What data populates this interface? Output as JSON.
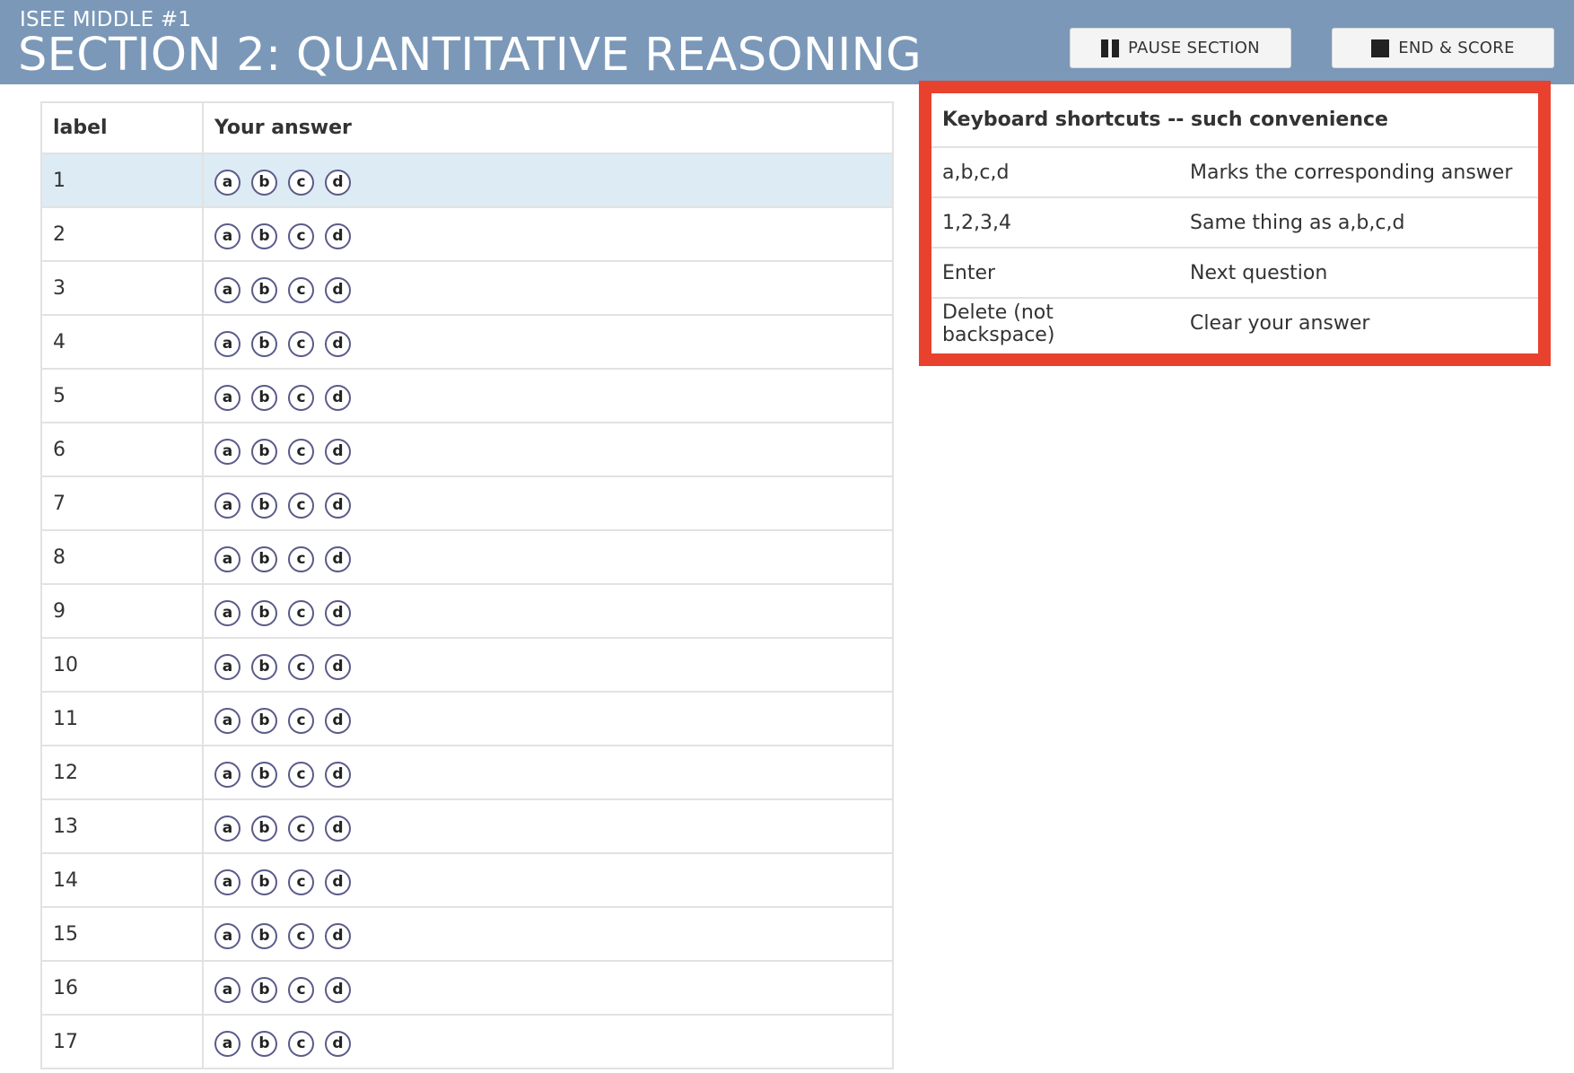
{
  "header": {
    "subtitle": "ISEE MIDDLE #1",
    "title": "SECTION 2: QUANTITATIVE REASONING",
    "pause_label": "PAUSE SECTION",
    "end_label": "END & SCORE",
    "background_color": "#7b98b8"
  },
  "answers_table": {
    "columns": [
      "label",
      "Your answer"
    ],
    "choices": [
      "a",
      "b",
      "c",
      "d"
    ],
    "rows": [
      "1",
      "2",
      "3",
      "4",
      "5",
      "6",
      "7",
      "8",
      "9",
      "10",
      "11",
      "12",
      "13",
      "14",
      "15",
      "16",
      "17"
    ],
    "active_row": "1"
  },
  "shortcuts": {
    "title": "Keyboard shortcuts -- such convenience",
    "highlight_color": "#e8412e",
    "items": [
      {
        "key": "a,b,c,d",
        "desc": "Marks the corresponding answer"
      },
      {
        "key": "1,2,3,4",
        "desc": "Same thing as a,b,c,d"
      },
      {
        "key": "Enter",
        "desc": "Next question"
      },
      {
        "key": "Delete (not backspace)",
        "desc": "Clear your answer"
      }
    ]
  }
}
